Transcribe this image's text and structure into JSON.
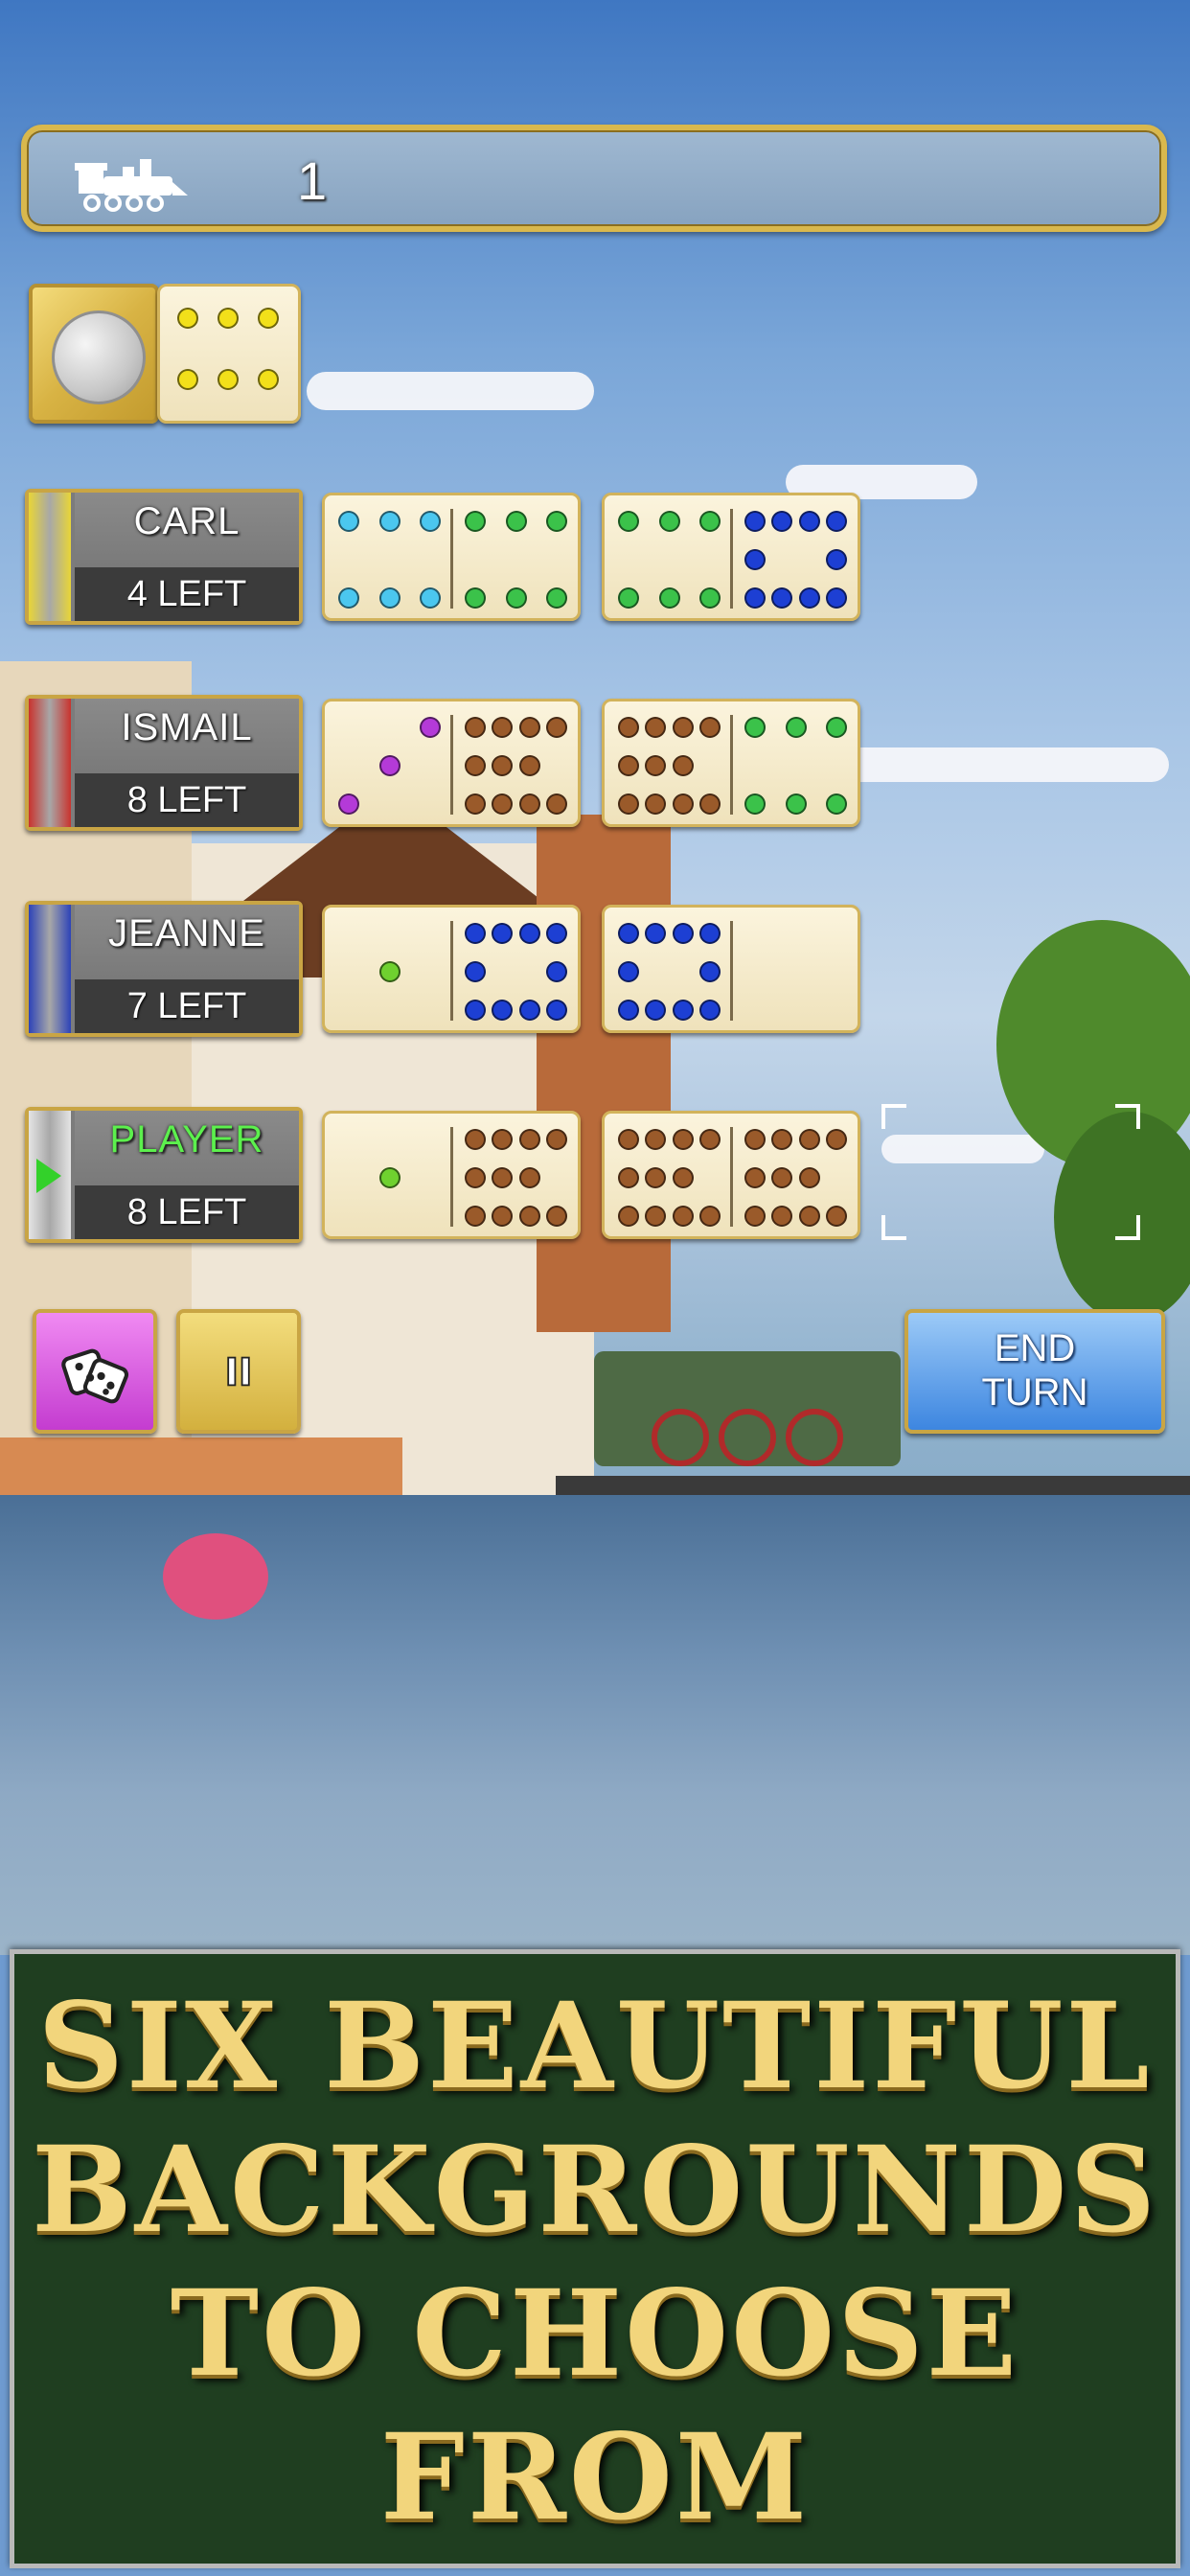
{
  "score": {
    "value": "1",
    "icon": "locomotive-icon"
  },
  "spinner": {
    "coin_icon": "nickel-coin-icon",
    "left_pips": 0,
    "right_pips": 6,
    "pip_color": "#f2e01a"
  },
  "players": [
    {
      "name": "CARL",
      "left": "4 LEFT",
      "tab_color": "#e8d537",
      "name_color": "#ffffff",
      "active": false,
      "dominoes": [
        {
          "l": 6,
          "r": 6,
          "lc": "#4bc7ef",
          "rc": "#3bc24a"
        },
        {
          "l": 6,
          "r": 10,
          "lc": "#3bc24a",
          "rc": "#1d3fd3"
        }
      ]
    },
    {
      "name": "ISMAIL",
      "left": "8 LEFT",
      "tab_color": "#c9332e",
      "name_color": "#ffffff",
      "active": false,
      "dominoes": [
        {
          "l": 3,
          "r": 11,
          "lc": "#b43ad8",
          "rc": "#9a5a2a"
        },
        {
          "l": 11,
          "r": 6,
          "lc": "#9a5a2a",
          "rc": "#3bc24a"
        }
      ]
    },
    {
      "name": "JEANNE",
      "left": "7 LEFT",
      "tab_color": "#2d43b8",
      "name_color": "#ffffff",
      "active": false,
      "dominoes": [
        {
          "l": 1,
          "r": 10,
          "lc": "#6fd12f",
          "rc": "#1d3fd3"
        },
        {
          "l": 10,
          "r": 0,
          "lc": "#1d3fd3",
          "rc": "#1d3fd3"
        }
      ]
    },
    {
      "name": "PLAYER",
      "left": "8 LEFT",
      "tab_color": "#e4e4e4",
      "name_color": "#5cf04d",
      "active": true,
      "dominoes": [
        {
          "l": 1,
          "r": 11,
          "lc": "#6fd12f",
          "rc": "#9a5a2a"
        },
        {
          "l": 11,
          "r": 11,
          "lc": "#9a5a2a",
          "rc": "#9a5a2a"
        }
      ]
    }
  ],
  "buttons": {
    "dice_icon": "dice-icon",
    "pause_icon": "pause-icon",
    "end_turn": "END\nTURN"
  },
  "banner": {
    "text": "SIX BEAUTIFUL\nBACKGROUNDS\nTO CHOOSE\nFROM"
  }
}
